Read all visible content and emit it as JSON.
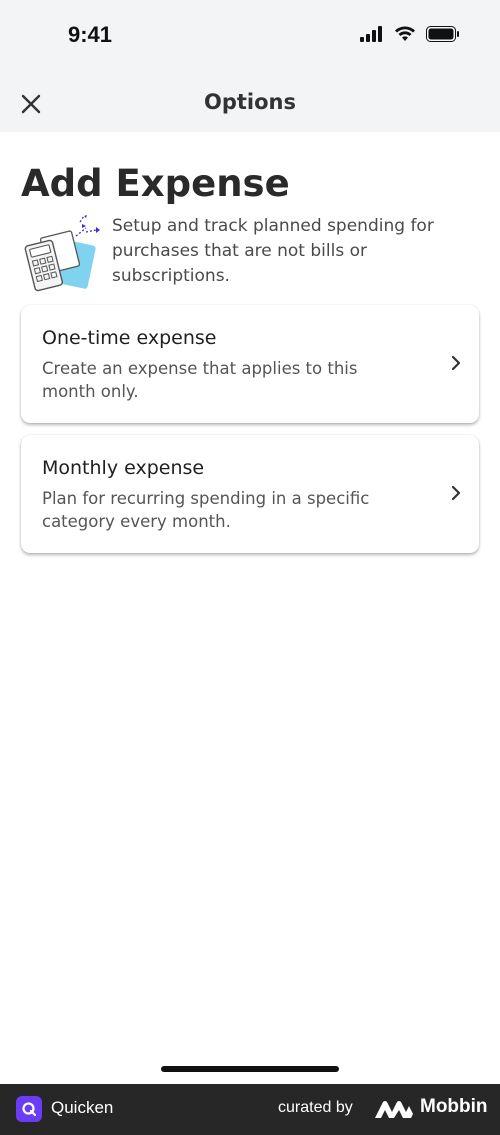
{
  "status_bar": {
    "time": "9:41",
    "icons": [
      "signal-icon",
      "wifi-icon",
      "battery-icon"
    ]
  },
  "nav": {
    "title": "Options",
    "close_icon": "close-icon"
  },
  "page": {
    "title": "Add Expense",
    "intro": "Setup and track planned spending for purchases that are not bills or subscriptions.",
    "illustration": "calculator-illustration"
  },
  "options": [
    {
      "title": "One-time expense",
      "description": "Create an expense that applies to this month only.",
      "icon": "chevron-right-icon"
    },
    {
      "title": "Monthly expense",
      "description": "Plan for recurring spending in a specific category every month.",
      "icon": "chevron-right-icon"
    }
  ],
  "footer": {
    "app_name": "Quicken",
    "curated_by": "curated by",
    "brand": "Mobbin",
    "logo_color": "#6a3cf5"
  },
  "colors": {
    "header_bg": "#f3f4f5",
    "footer_bg": "#272727",
    "illustration_accent": "#7fd3ee",
    "illustration_sparkle": "#3a2fd6"
  }
}
